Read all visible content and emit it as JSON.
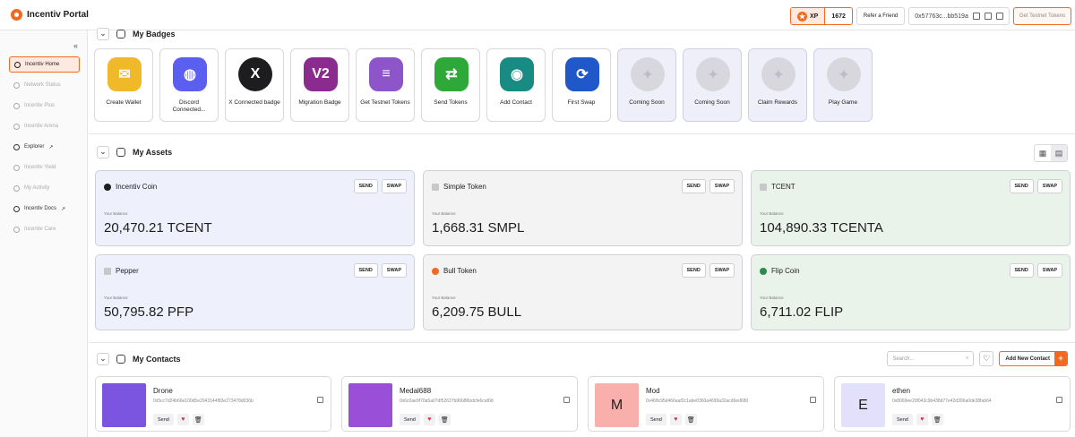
{
  "app": {
    "name": "Incentiv Portal"
  },
  "header": {
    "xp_label": "XP",
    "xp_value": "1672",
    "refer_label": "Refer a Friend",
    "address": "0x57763c...bb519a",
    "testnet_label": "Get Testnet Tokens"
  },
  "sidebar": {
    "collapse": "«",
    "items": [
      {
        "label": "Incentiv Home",
        "state": "active"
      },
      {
        "label": "Network Status",
        "state": "disabled"
      },
      {
        "label": "Incentiv Plus",
        "state": "disabled"
      },
      {
        "label": "Incentiv Arena",
        "state": "disabled"
      },
      {
        "label": "Explorer",
        "state": "enabled",
        "external": "↗"
      },
      {
        "label": "Incentiv Yield",
        "state": "disabled"
      },
      {
        "label": "My Activity",
        "state": "disabled"
      },
      {
        "label": "Incentiv Docs",
        "state": "enabled",
        "external": "↗"
      },
      {
        "label": "Incentiv Care",
        "state": "disabled"
      }
    ]
  },
  "badges": {
    "title": "My Badges",
    "items": [
      {
        "label": "Create Wallet",
        "color": "#f0b92a",
        "glyph": "✉"
      },
      {
        "label": "Discord Connected...",
        "color": "#5a5ff0",
        "glyph": "◍"
      },
      {
        "label": "X Connected badge",
        "color": "#1d1d1f",
        "glyph": "X"
      },
      {
        "label": "Migration Badge",
        "color": "#8b2b8f",
        "glyph": "V2"
      },
      {
        "label": "Get Testnet Tokens",
        "color": "#8e54c9",
        "glyph": "≡"
      },
      {
        "label": "Send Tokens",
        "color": "#2fa83a",
        "glyph": "⇄"
      },
      {
        "label": "Add Contact",
        "color": "#188b83",
        "glyph": "◉"
      },
      {
        "label": "First Swap",
        "color": "#2057c9",
        "glyph": "⟳"
      },
      {
        "label": "Coming Soon",
        "color": "#d7d7dd",
        "glyph": "✦"
      },
      {
        "label": "Coming Soon",
        "color": "#d7d7dd",
        "glyph": "✦"
      },
      {
        "label": "Claim Rewards",
        "color": "#d7d7dd",
        "glyph": "✦"
      },
      {
        "label": "Play Game",
        "color": "#d7d7dd",
        "glyph": "✦"
      }
    ]
  },
  "assets": {
    "title": "My Assets",
    "send_label": "SEND",
    "swap_label": "SWAP",
    "balance_caption": "Your Balance",
    "items": [
      {
        "name": "Incentiv Coin",
        "balance": "20,470.21 TCENT"
      },
      {
        "name": "Simple Token",
        "balance": "1,668.31 SMPL"
      },
      {
        "name": "TCENT",
        "balance": "104,890.33 TCENTA"
      },
      {
        "name": "Pepper",
        "balance": "50,795.82 PFP"
      },
      {
        "name": "Bull Token",
        "balance": "6,209.75 BULL"
      },
      {
        "name": "Flip Coin",
        "balance": "6,711.02 FLIP"
      }
    ]
  },
  "contacts": {
    "title": "My Contacts",
    "search_placeholder": "Search...",
    "add_label": "Add New Contact",
    "send_label": "Send",
    "items": [
      {
        "name": "Drone",
        "address": "0x5cc7d24b66e100d5e2043144f83e273478d036b",
        "avatar_text": "",
        "avatar_color": "#7b55e0"
      },
      {
        "name": "Medal688",
        "address": "0x6c0ae9f70a5a07df52637b96b86bdcfe6caf0d",
        "avatar_text": "",
        "avatar_color": "#9a4fd8"
      },
      {
        "name": "Mod",
        "address": "0x468c95d466aaf2c1abe0360a4699a32acd6ed680",
        "avatar_text": "M",
        "avatar_color": "#f9b0ad"
      },
      {
        "name": "ethen",
        "address": "0x8069ee20f043c9b438d77e42d396a0de38fab64",
        "avatar_text": "E",
        "avatar_color": "#e2e0fb"
      }
    ]
  }
}
